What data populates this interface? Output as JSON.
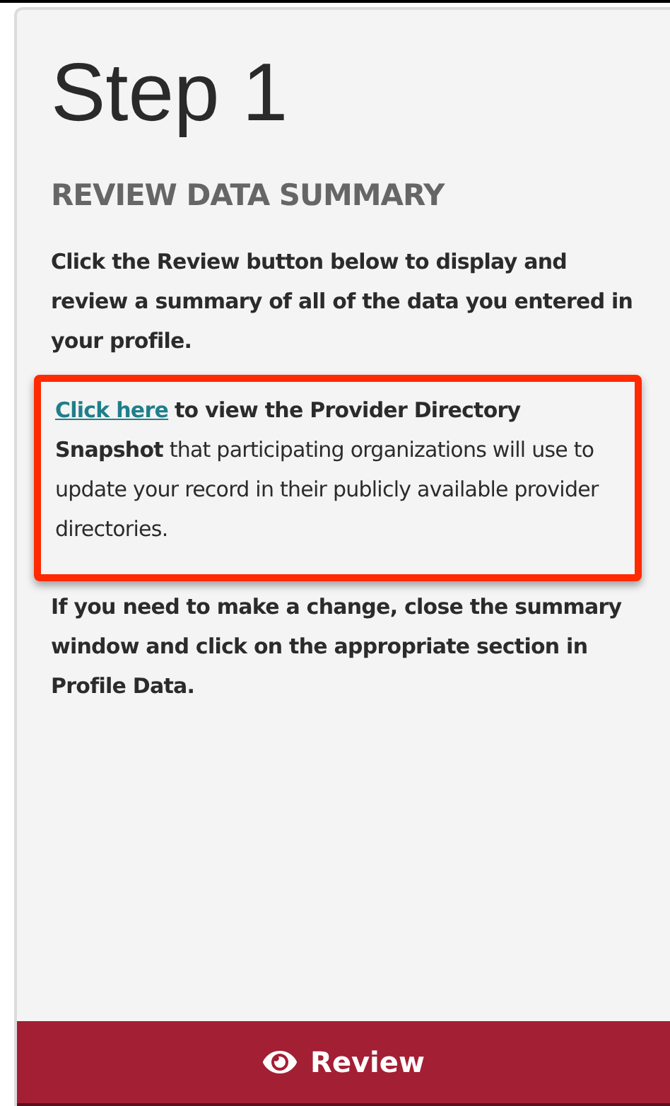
{
  "step_title": "Step 1",
  "section_heading": "REVIEW DATA SUMMARY",
  "intro": "Click the Review button below to display and review a summary of all of the data you entered in your profile.",
  "snapshot": {
    "link": "Click here",
    "text": "**to view the Provider Directory Snapshot** that participating organizations will use to update your record in their publicly available provider directories.",
    "highlighted": true
  },
  "change_note": "If you need to make a change, close the summary window and click on the appropriate section in Profile Data.",
  "review_button": {
    "label": "Review"
  }
}
